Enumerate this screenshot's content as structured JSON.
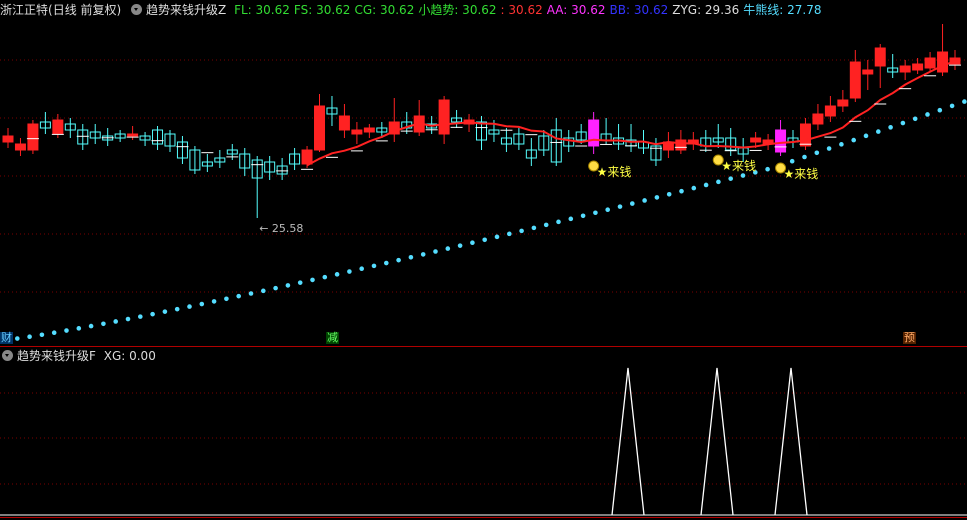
{
  "main_header": {
    "title": "浙江正特",
    "period": "(日线 前复权)",
    "indicator": "趋势来钱升级Z",
    "values": [
      {
        "label": "FL: 30.62",
        "color": "#33dd33"
      },
      {
        "label": "FS: 30.62",
        "color": "#33dd33"
      },
      {
        "label": "CG: 30.62",
        "color": "#33dd33"
      },
      {
        "label": "小趋势: 30.62",
        "color": "#33dd33"
      },
      {
        "label": ": 30.62",
        "color": "#ff3333"
      },
      {
        "label": "AA: 30.62",
        "color": "#ff33ff"
      },
      {
        "label": "BB: 30.62",
        "color": "#3333ff"
      },
      {
        "label": "ZYG: 29.36",
        "color": "#dddddd"
      },
      {
        "label": "牛熊线: 27.78",
        "color": "#55ddff"
      }
    ]
  },
  "sub_header": {
    "indicator": "趋势来钱升级F",
    "values": [
      {
        "label": "XG: 0.00",
        "color": "#dddddd"
      }
    ]
  },
  "low_annotation": "← 25.58",
  "signal_label": "来钱",
  "bottom_markers": [
    {
      "text": "财",
      "color": "#66ccff",
      "bg": "#003366"
    },
    {
      "text": "减",
      "color": "#66ff66",
      "bg": "#004400"
    },
    {
      "text": "预",
      "color": "#ffaa66",
      "bg": "#552200"
    }
  ],
  "colors": {
    "up": "#ff2222",
    "down": "#55ffff",
    "signal_candle": "#ff22ff",
    "trend_line": "#ff2222",
    "dots": "#55ddff",
    "grid": "#7a0000",
    "signal_text": "#ffff44"
  },
  "chart_data": {
    "type": "candlestick",
    "dots_range": [
      19.5,
      30.62
    ],
    "xg_signal_bars": [
      40,
      45,
      49
    ]
  }
}
